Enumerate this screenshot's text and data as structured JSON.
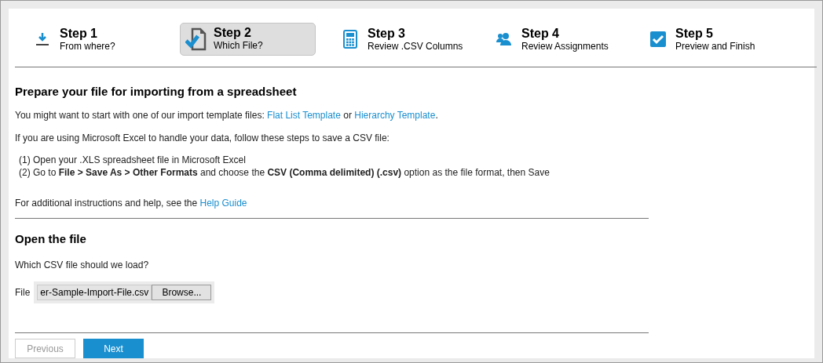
{
  "steps": [
    {
      "kind": "download",
      "title": "Step 1",
      "subtitle": "From where?",
      "selected": false
    },
    {
      "kind": "file-check",
      "title": "Step 2",
      "subtitle": "Which File?",
      "selected": true
    },
    {
      "kind": "calculator",
      "title": "Step 3",
      "subtitle": "Review .CSV Columns",
      "selected": false
    },
    {
      "kind": "people",
      "title": "Step 4",
      "subtitle": "Review Assignments",
      "selected": false
    },
    {
      "kind": "checkbox",
      "title": "Step 5",
      "subtitle": "Preview and Finish",
      "selected": false
    }
  ],
  "prepare": {
    "heading": "Prepare your file for importing from a spreadsheet",
    "intro": [
      {
        "kind": "text",
        "text": "You might want to start with one of our import template files: "
      },
      {
        "kind": "link",
        "text": "Flat List Template"
      },
      {
        "kind": "text",
        "text": " or "
      },
      {
        "kind": "link",
        "text": "Hierarchy Template"
      },
      {
        "kind": "text",
        "text": "."
      }
    ],
    "excel_note": "If you are using Microsoft Excel to handle your data, follow these steps to save a CSV file:",
    "instructions": [
      "(1) Open your .XLS spreadsheet file in Microsoft Excel",
      "(2) Go to **File > Save As > Other Formats** and choose the **CSV (Comma delimited) (.csv)** option as the file format, then Save"
    ],
    "help": [
      {
        "kind": "text",
        "text": "For additional instructions and help, see the "
      },
      {
        "kind": "link",
        "text": "Help Guide"
      }
    ]
  },
  "open_file": {
    "heading": "Open the file",
    "question": "Which CSV file should we load?",
    "field_label": "File",
    "file_value": "er-Sample-Import-File.csv",
    "browse_label": "Browse..."
  },
  "buttons": [
    {
      "label": "Previous",
      "kind": "secondary",
      "disabled": true
    },
    {
      "label": "Next",
      "kind": "primary",
      "disabled": false
    }
  ]
}
